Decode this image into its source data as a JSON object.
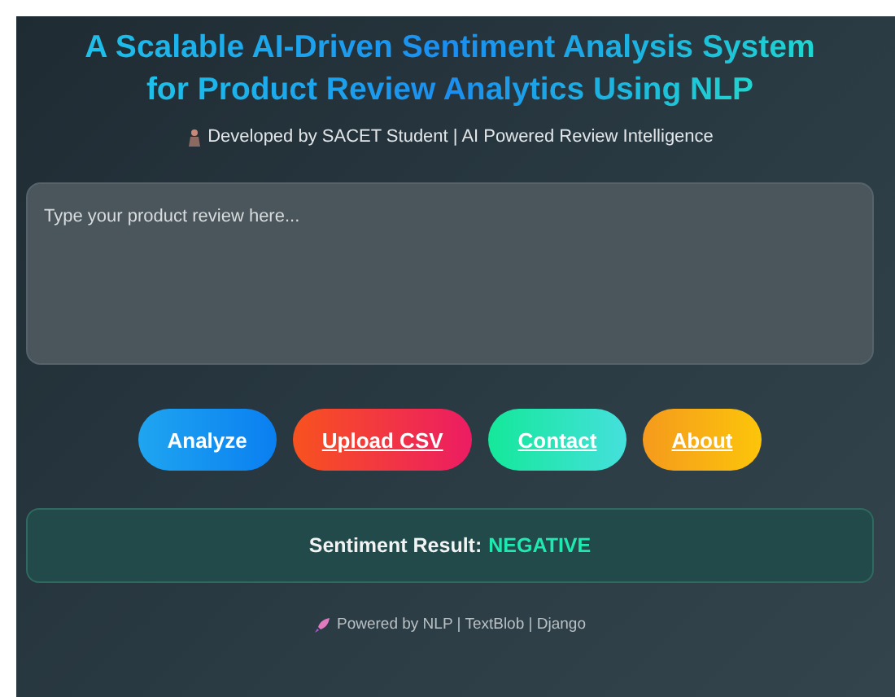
{
  "header": {
    "title_line_1": "A Scalable AI-Driven Sentiment Analysis System",
    "title_line_2": "for Product Review Analytics Using NLP",
    "subtitle": "Developed by SACET Student | AI Powered Review Intelligence"
  },
  "review_field": {
    "placeholder": "Type your product review here..."
  },
  "actions": [
    {
      "label": "Analyze",
      "kind": "button"
    },
    {
      "label": "Upload CSV",
      "kind": "link"
    },
    {
      "label": "Contact",
      "kind": "link"
    },
    {
      "label": "About",
      "kind": "link"
    }
  ],
  "result": {
    "label": "Sentiment Result:",
    "value": "NEGATIVE"
  },
  "footer": "Powered by NLP | TextBlob | Django"
}
